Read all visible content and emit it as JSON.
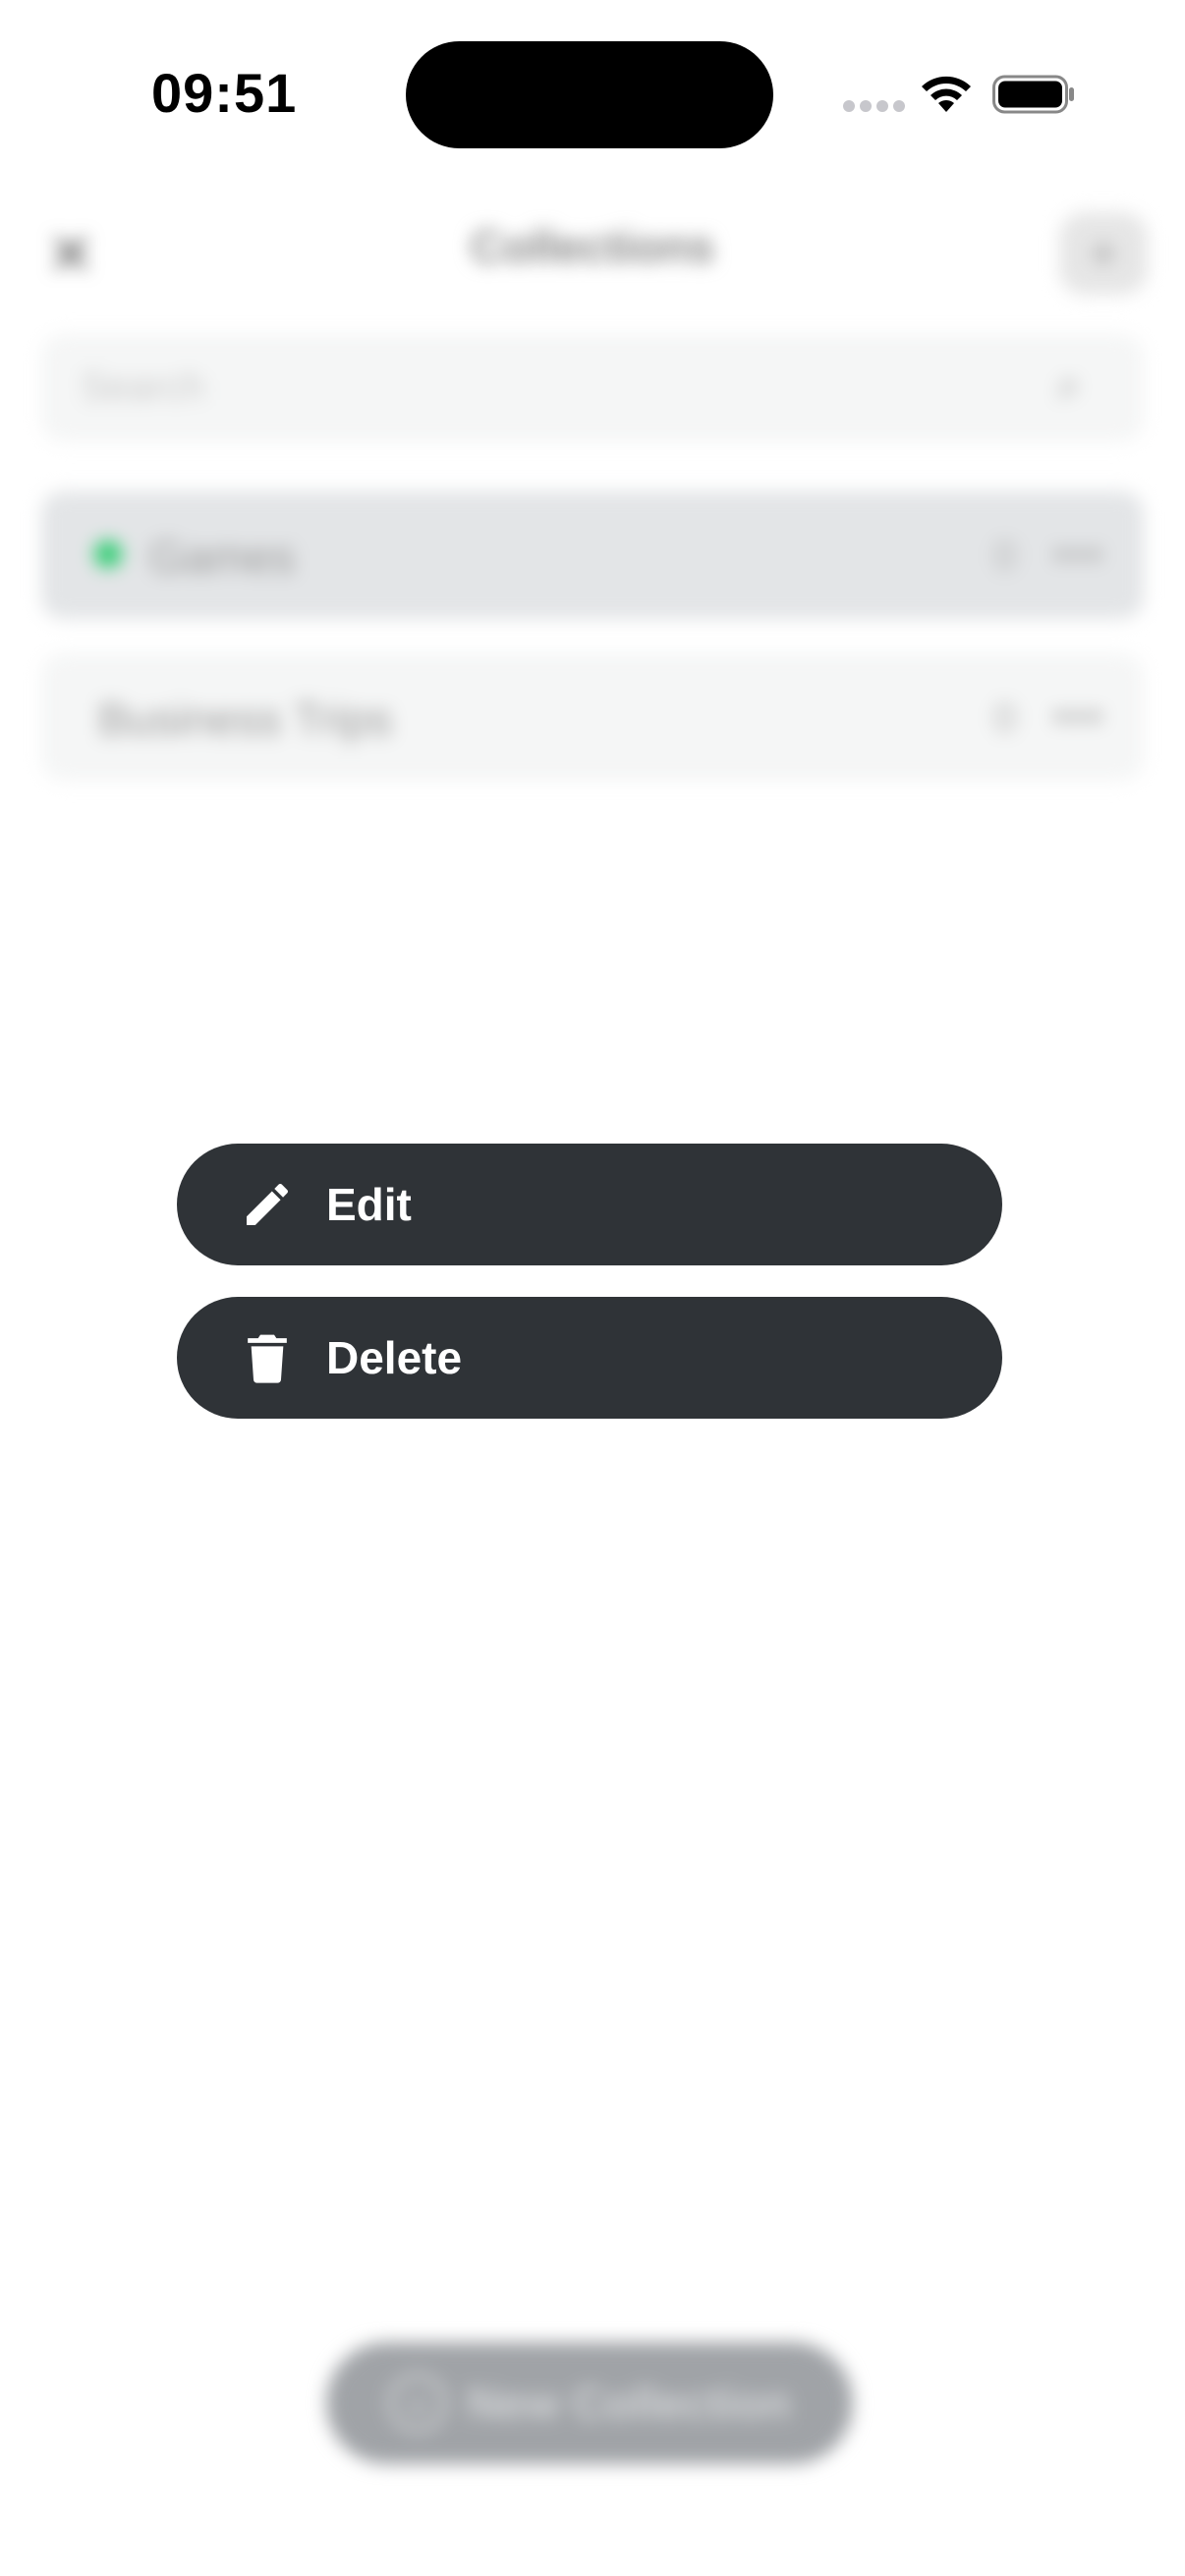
{
  "status_bar": {
    "time": "09:51"
  },
  "header": {
    "title": "Collections",
    "close_icon": "close-icon",
    "add_icon": "folder-add-icon"
  },
  "search": {
    "placeholder": "Search"
  },
  "collections": [
    {
      "label": "Games",
      "count": "0",
      "color": "#2ecc71"
    },
    {
      "label": "Business Trips",
      "count": "0"
    }
  ],
  "context_menu": {
    "items": [
      {
        "label": "Edit",
        "icon": "pencil-icon"
      },
      {
        "label": "Delete",
        "icon": "trash-icon"
      }
    ],
    "background": "#2f3337",
    "text_color": "#ffffff"
  },
  "footer": {
    "new_collection_label": "New Collection"
  }
}
